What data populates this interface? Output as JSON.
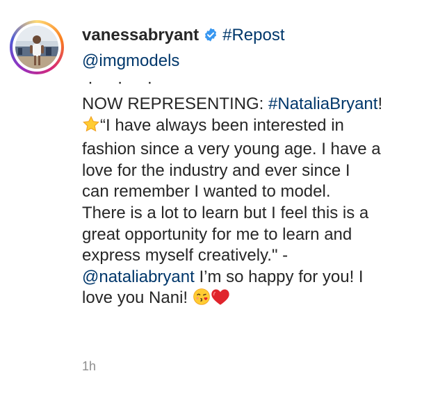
{
  "post": {
    "username": "vanessabryant",
    "repost_tag": "#Repost",
    "source_mention": "@imgmodels",
    "dots": "· · ·",
    "lines": {
      "l1_prefix": "NOW REPRESENTING: ",
      "l1_hashtag": "#NataliaBryant",
      "l1_suffix": "!",
      "l2": "“I have always been interested in",
      "l3": "fashion since a very young age. I have a",
      "l4": "love for the industry and ever since I",
      "l5": "can remember I wanted to model.",
      "l6": "There is a lot to learn but I feel this is a",
      "l7": "great opportunity for me to learn and",
      "l8": "express myself creatively.\" -",
      "l9_mention": "@nataliabryant",
      "l9_suffix": " I’m so happy for you! I",
      "l10": "love you Nani! "
    },
    "timestamp": "1h"
  },
  "icons": {
    "verified": "verified-badge-icon",
    "star": "star-emoji-icon",
    "kiss": "kissing-face-emoji-icon",
    "heart": "red-heart-emoji-icon"
  },
  "colors": {
    "text": "#262626",
    "link": "#00376b",
    "verified": "#3897f0",
    "timestamp": "#8e8e8e"
  }
}
